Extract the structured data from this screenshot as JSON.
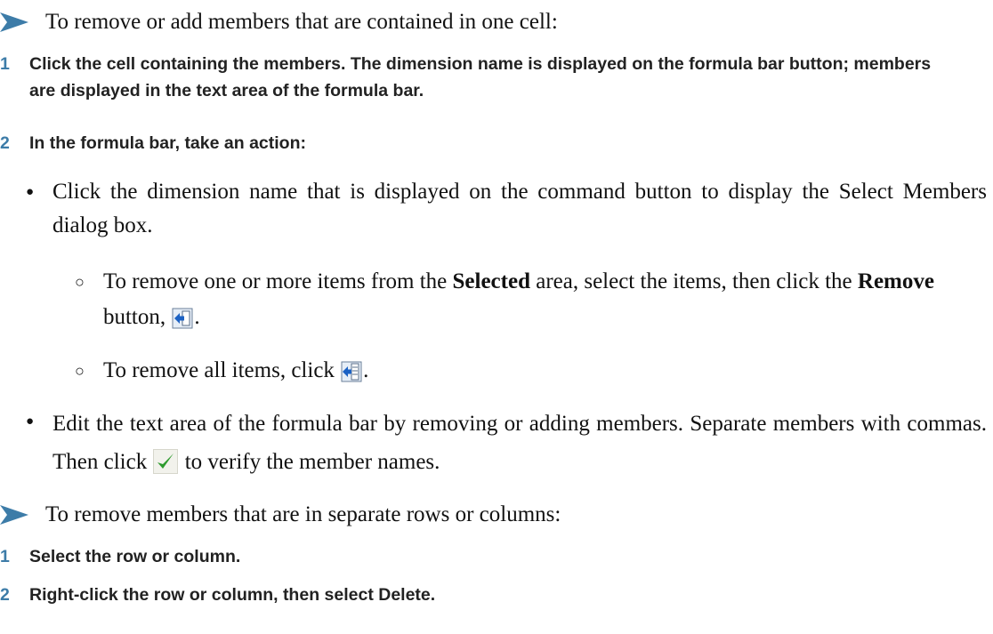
{
  "section1": {
    "heading": "To remove or add members that are contained in one cell:",
    "steps": [
      {
        "num": "1",
        "text": "Click the cell containing the members. The dimension name is displayed on the formula bar button; members are displayed in the text area of the formula bar."
      },
      {
        "num": "2",
        "text": "In the formula bar, take an action:"
      }
    ],
    "bullets": [
      {
        "text": "Click the dimension name that is displayed on the command button to display the Select Members dialog box."
      },
      {
        "text_a": "Edit the text area of the formula bar by removing or adding members. Separate members with commas. Then click",
        "text_b": "to verify the member names."
      }
    ],
    "subbullets": [
      {
        "a": "To remove one or more items from the",
        "b": "Selected",
        "c": "area, select the items, then click the",
        "d": "Remove",
        "e": "button,",
        "f": "."
      },
      {
        "a": "To remove all items, click",
        "f": "."
      }
    ]
  },
  "section2": {
    "heading": "To remove members that are in separate rows or columns:",
    "steps": [
      {
        "num": "1",
        "text": "Select the row or column."
      },
      {
        "num": "2",
        "text_a": "Right-click the row or column, then select",
        "text_b": "Delete",
        "text_c": "."
      }
    ]
  },
  "icons": {
    "remove_icon": "remove-arrow-icon",
    "remove_all_icon": "remove-all-icon",
    "verify_icon": "green-checkmark-icon"
  },
  "colors": {
    "step_number": "#3d7ca8",
    "arrow": "#3d7ca8",
    "check": "#2e9b2e"
  }
}
